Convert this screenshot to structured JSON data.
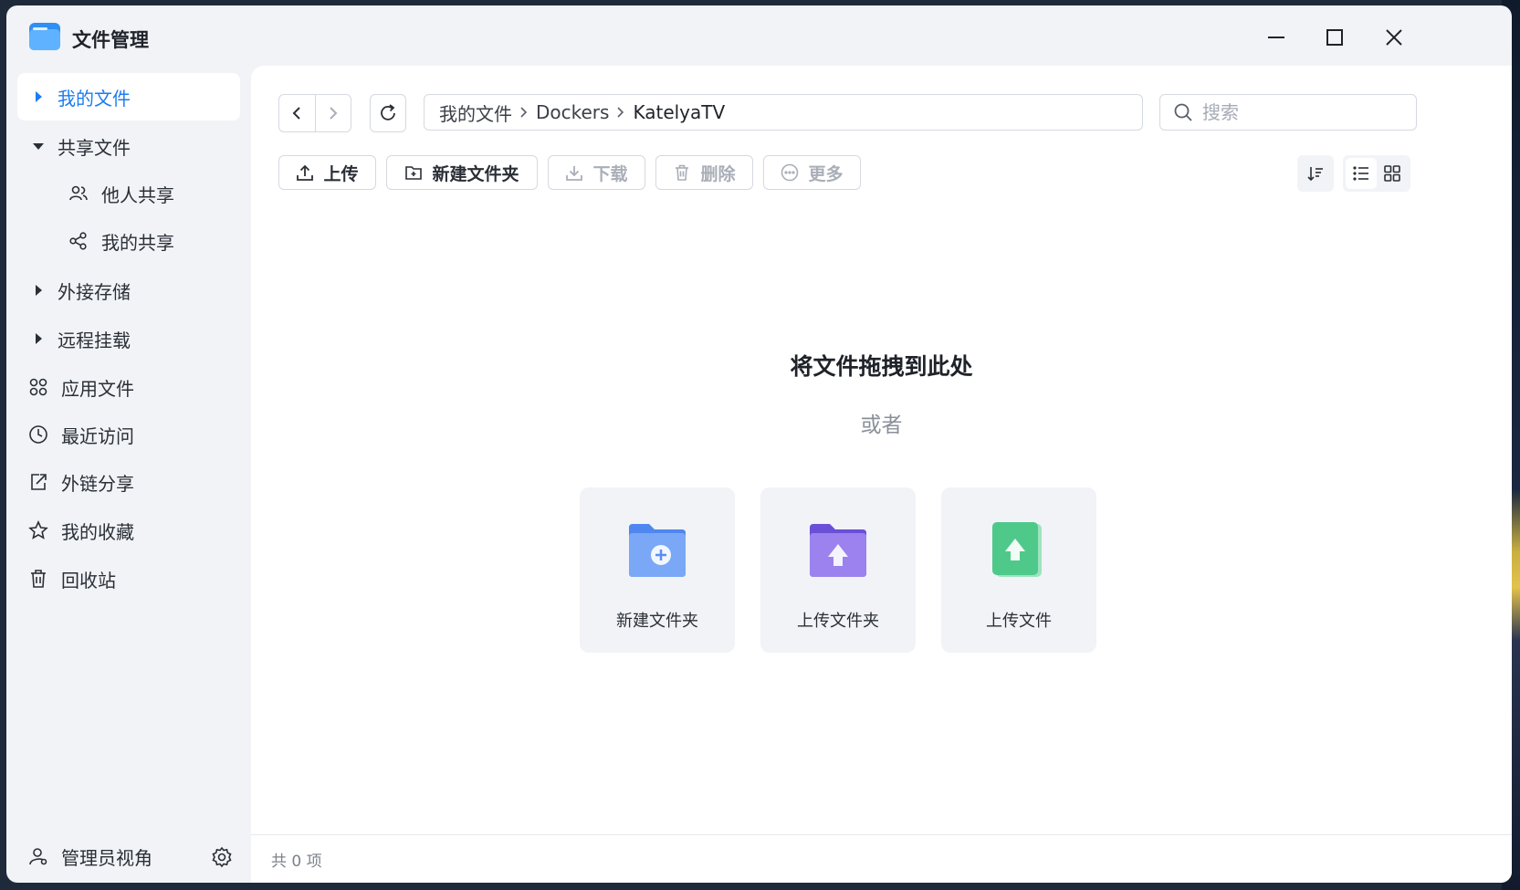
{
  "window": {
    "title": "文件管理",
    "controls": {
      "minimize": "minimize",
      "maximize": "maximize",
      "close": "close"
    }
  },
  "sidebar": {
    "items": [
      {
        "label": "我的文件",
        "icon": "caret-right-icon",
        "active": true
      },
      {
        "label": "共享文件",
        "icon": "caret-down-icon"
      },
      {
        "label": "他人共享",
        "icon": "users-icon"
      },
      {
        "label": "我的共享",
        "icon": "share-icon"
      },
      {
        "label": "外接存储",
        "icon": "caret-right-icon"
      },
      {
        "label": "远程挂载",
        "icon": "caret-right-icon"
      },
      {
        "label": "应用文件",
        "icon": "apps-icon"
      },
      {
        "label": "最近访问",
        "icon": "clock-icon"
      },
      {
        "label": "外链分享",
        "icon": "external-share-icon"
      },
      {
        "label": "我的收藏",
        "icon": "star-icon"
      },
      {
        "label": "回收站",
        "icon": "trash-icon"
      }
    ],
    "footer": {
      "label": "管理员视角"
    }
  },
  "toolbar": {
    "breadcrumb": [
      "我的文件",
      "Dockers",
      "KatelyaTV"
    ],
    "search_placeholder": "搜索",
    "upload": "上传",
    "new_folder": "新建文件夹",
    "download": "下载",
    "delete": "删除",
    "more": "更多"
  },
  "empty": {
    "title": "将文件拖拽到此处",
    "or": "或者",
    "actions": [
      {
        "label": "新建文件夹",
        "icon": "new-folder-illustration",
        "color": "#5b8df5"
      },
      {
        "label": "上传文件夹",
        "icon": "upload-folder-illustration",
        "color": "#7c5ce6"
      },
      {
        "label": "上传文件",
        "icon": "upload-file-illustration",
        "color": "#4ec98a"
      }
    ]
  },
  "status": {
    "count": "共 0 项"
  },
  "colors": {
    "accent": "#1c7cf0",
    "sidebar_bg": "#f1f3f7",
    "main_bg": "#ffffff"
  }
}
